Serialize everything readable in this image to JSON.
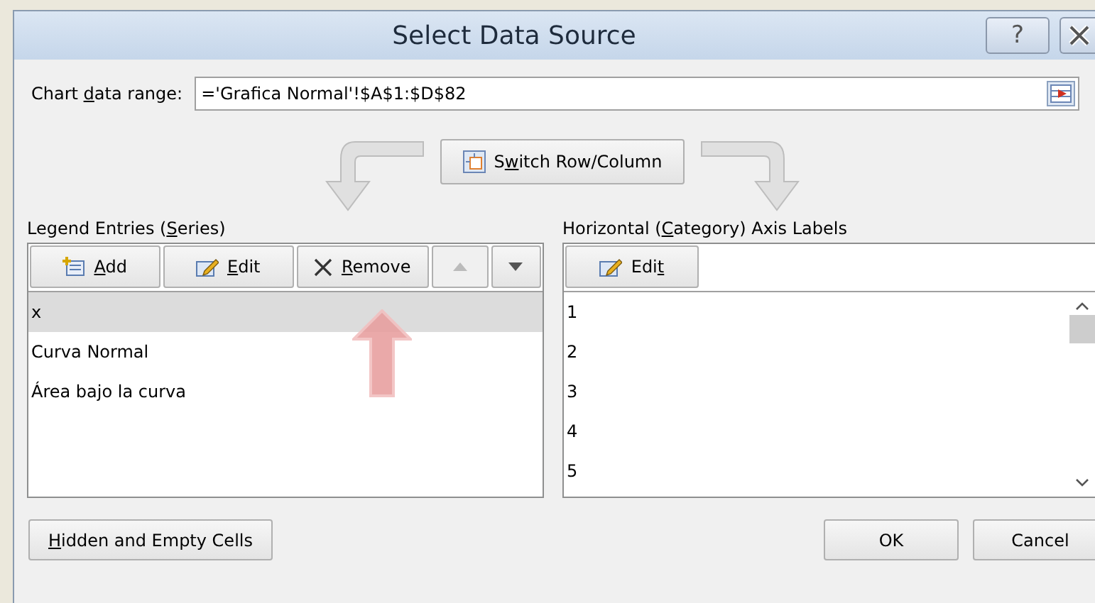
{
  "window": {
    "title": "Select Data Source",
    "help_label": "?"
  },
  "range": {
    "label": {
      "pre": "Chart ",
      "key": "d",
      "post": "ata range:"
    },
    "value": "='Grafica Normal'!$A$1:$D$82"
  },
  "switch_button": {
    "label": {
      "pre": "S",
      "key": "w",
      "post": "itch Row/Column"
    }
  },
  "legend": {
    "title": {
      "pre": "Legend Entries (",
      "key": "S",
      "post": "eries)"
    },
    "buttons": [
      {
        "kind": "add",
        "label": {
          "key": "A",
          "post": "dd"
        },
        "disabled": false
      },
      {
        "kind": "edit",
        "label": {
          "key": "E",
          "post": "dit"
        },
        "disabled": false
      },
      {
        "kind": "remove",
        "label": {
          "key": "R",
          "post": "emove"
        },
        "disabled": false
      },
      {
        "kind": "up",
        "disabled": true
      },
      {
        "kind": "down",
        "disabled": false
      }
    ],
    "items": [
      {
        "label": "x",
        "selected": true
      },
      {
        "label": "Curva Normal",
        "selected": false
      },
      {
        "label": "Área bajo la curva",
        "selected": false
      }
    ]
  },
  "axis": {
    "title": {
      "pre": "Horizontal (",
      "key": "C",
      "post": "ategory) Axis Labels"
    },
    "buttons": [
      {
        "kind": "edit",
        "label": {
          "pre": "Edi",
          "key": "t"
        },
        "disabled": false
      }
    ],
    "items": [
      {
        "label": "1",
        "selected": false
      },
      {
        "label": "2",
        "selected": false
      },
      {
        "label": "3",
        "selected": false
      },
      {
        "label": "4",
        "selected": false
      },
      {
        "label": "5",
        "selected": false
      }
    ]
  },
  "footer": {
    "hidden_button": {
      "key": "H",
      "post": "idden and Empty Cells"
    },
    "ok": "OK",
    "cancel": "Cancel"
  }
}
